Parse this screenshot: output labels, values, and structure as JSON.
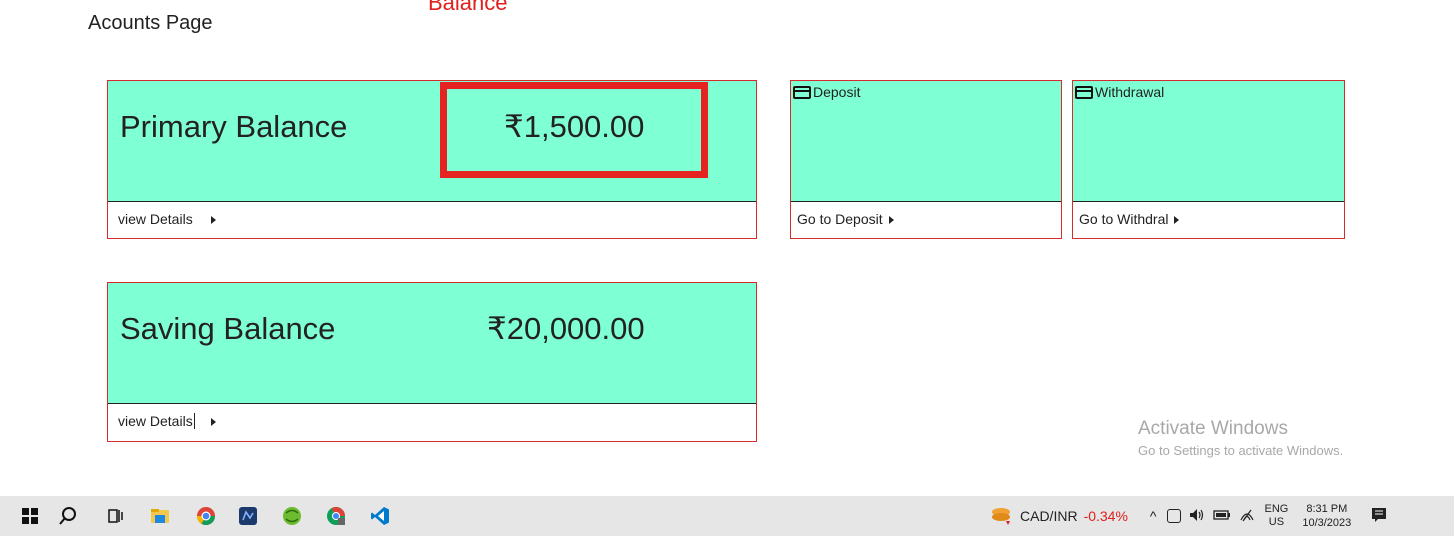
{
  "page": {
    "title": "Acounts Page",
    "annotation": "Balance"
  },
  "accounts": [
    {
      "label": "Primary Balance",
      "amount": "₹1,500.00",
      "footer": "view Details"
    },
    {
      "label": "Saving Balance",
      "amount": "₹20,000.00",
      "footer": "view Details"
    }
  ],
  "actions": {
    "deposit": {
      "title": "Deposit",
      "footer": "Go to Deposit"
    },
    "withdrawal": {
      "title": "Withdrawal",
      "footer": "Go to Withdral"
    }
  },
  "watermark": {
    "line1": "Activate Windows",
    "line2": "Go to Settings to activate Windows."
  },
  "taskbar": {
    "ticker_pair": "CAD/INR",
    "ticker_change": "-0.34%",
    "lang": "ENG",
    "region": "US",
    "time": "8:31 PM",
    "date": "10/3/2023",
    "icons": [
      "windows-start-icon",
      "search-icon",
      "task-view-icon",
      "file-explorer-icon",
      "chrome-icon",
      "app-icon",
      "eclipse-icon",
      "chrome-alt-icon",
      "vscode-icon"
    ]
  },
  "colors": {
    "card_bg": "#7fffd4",
    "card_border": "#d72c2c",
    "highlight": "#e52422",
    "ticker_negative": "#e0201d"
  }
}
